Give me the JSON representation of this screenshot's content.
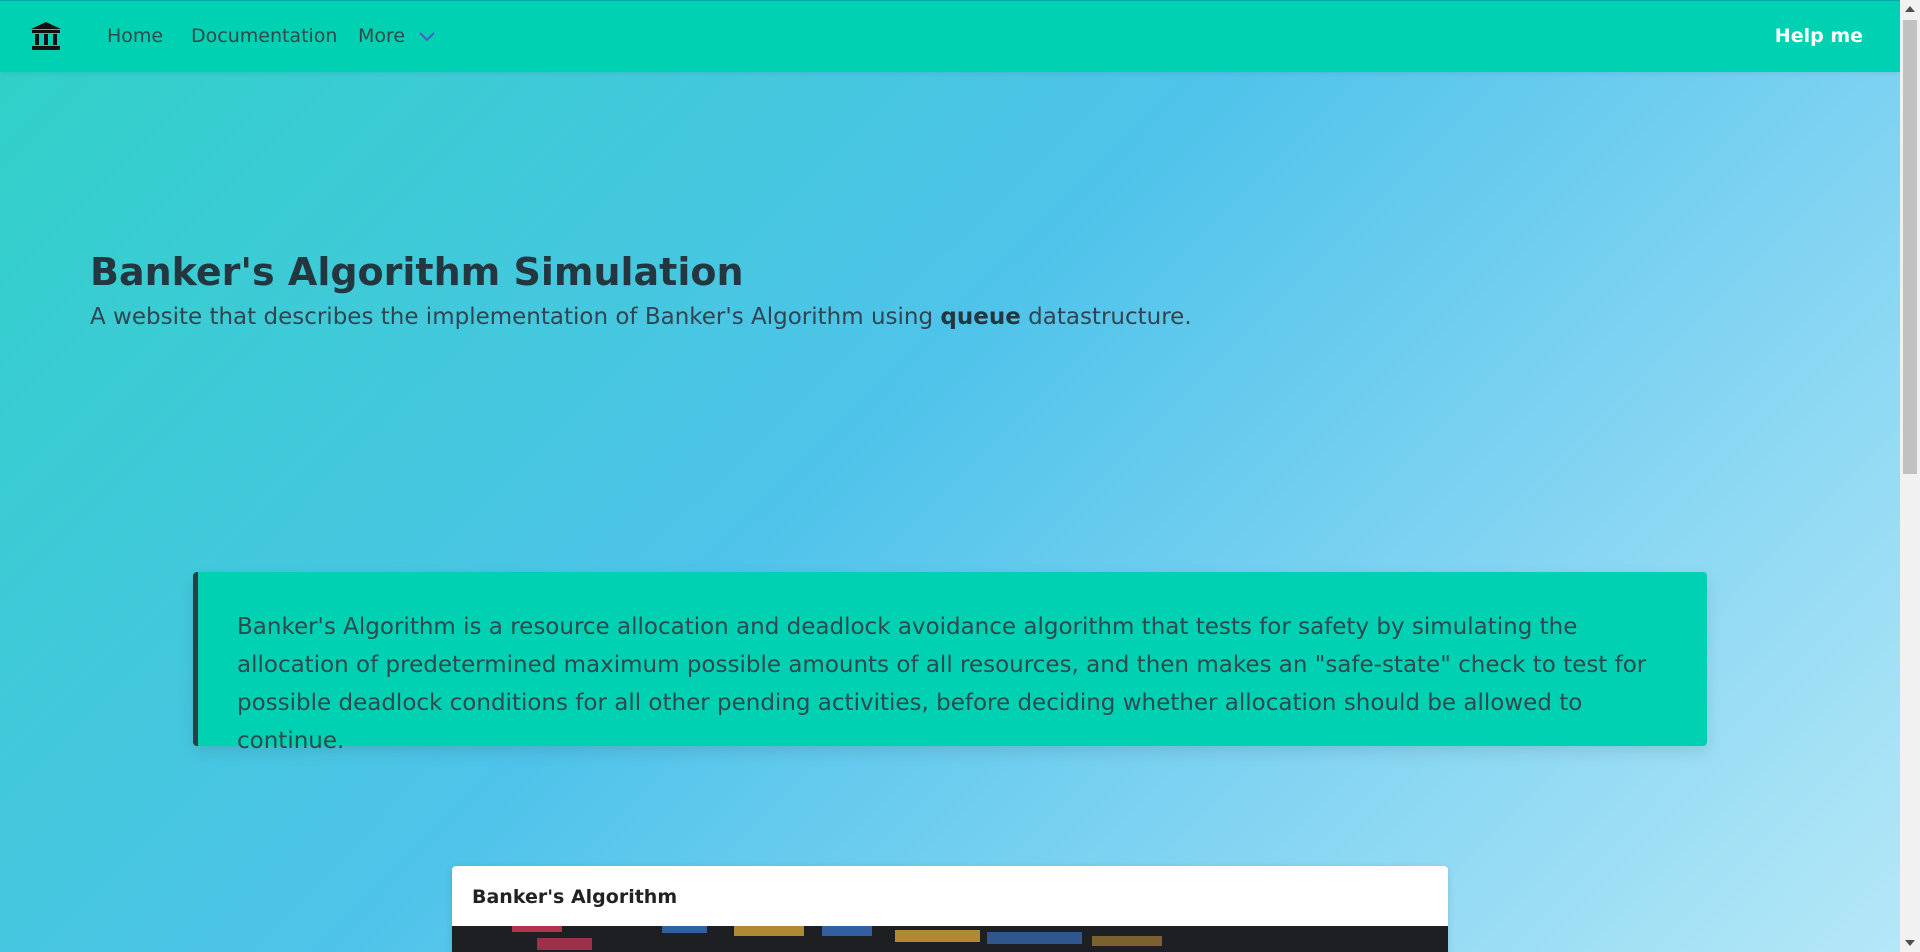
{
  "nav": {
    "home": "Home",
    "documentation": "Documentation",
    "more": "More",
    "help": "Help me",
    "brand_icon": "bank-icon",
    "colors": {
      "navbar": "#00d1b2",
      "chevron": "#485fc7"
    }
  },
  "hero": {
    "title": "Banker's Algorithm Simulation",
    "subtitle_before": "A website that describes the implementation of Banker's Algorithm using ",
    "subtitle_bold": "queue",
    "subtitle_after": " datastructure."
  },
  "callout": {
    "text": "Banker's Algorithm is a resource allocation and deadlock avoidance algorithm that tests for safety by simulating the allocation of predetermined maximum possible amounts of all resources, and then makes an \"safe-state\" check to test for possible deadlock conditions for all other pending activities, before deciding whether allocation should be allowed to continue."
  },
  "card": {
    "title": "Banker's Algorithm"
  }
}
